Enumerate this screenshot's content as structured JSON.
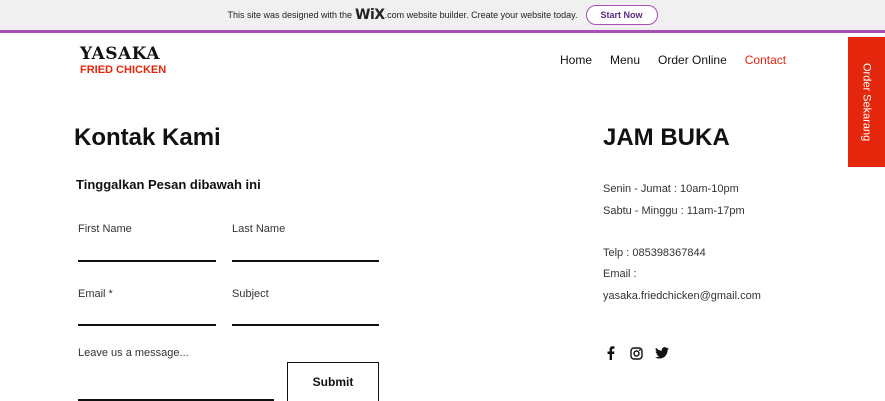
{
  "banner": {
    "text_before": "This site was designed with the",
    "wix": "WiX",
    "text_after": ".com website builder. Create your website today.",
    "cta": "Start Now"
  },
  "logo": {
    "line1": "YASAKA",
    "line2": "FRIED CHICKEN"
  },
  "nav": {
    "home": "Home",
    "menu": "Menu",
    "order": "Order Online",
    "contact": "Contact"
  },
  "side_tab": "Order Sekarang",
  "contact": {
    "title": "Kontak Kami",
    "subtitle": "Tinggalkan Pesan dibawah ini",
    "first_name": "First Name",
    "last_name": "Last Name",
    "email": "Email *",
    "subject": "Subject",
    "message": "Leave us a message...",
    "submit": "Submit"
  },
  "hours": {
    "title": "JAM BUKA",
    "weekday": "Senin - Jumat : 10am-10pm",
    "weekend": "Sabtu - Minggu : 11am-17pm",
    "phone": "Telp : 085398367844",
    "email_label": "Email :",
    "email": "yasaka.friedchicken@gmail.com"
  },
  "colors": {
    "brand_red": "#e3260c",
    "wix_purple": "#a74fb4"
  },
  "icons": [
    "facebook-icon",
    "instagram-icon",
    "twitter-icon"
  ]
}
